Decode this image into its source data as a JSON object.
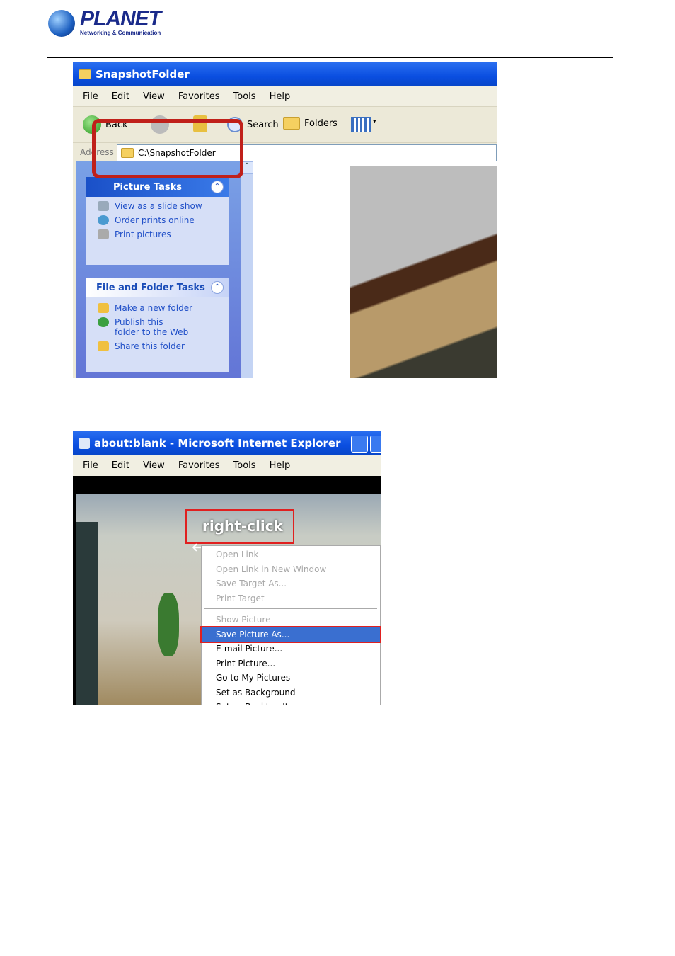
{
  "logo": {
    "brand": "PLANET",
    "tagline": "Networking & Communication"
  },
  "explorer": {
    "title": "SnapshotFolder",
    "menu": [
      "File",
      "Edit",
      "View",
      "Favorites",
      "Tools",
      "Help"
    ],
    "toolbar": {
      "back": "Back",
      "search": "Search",
      "folders": "Folders"
    },
    "address_label": "Address",
    "address_value": "C:\\SnapshotFolder",
    "picture_tasks": {
      "title": "Picture Tasks",
      "items": [
        "View as a slide show",
        "Order prints online",
        "Print pictures"
      ]
    },
    "file_folder_tasks": {
      "title": "File and Folder Tasks",
      "items": [
        "Make a new folder",
        "Publish this folder to the Web",
        "Share this folder"
      ]
    },
    "highlight_color": "#c0201a"
  },
  "ie": {
    "title": "about:blank - Microsoft Internet Explorer",
    "menu": [
      "File",
      "Edit",
      "View",
      "Favorites",
      "Tools",
      "Help"
    ],
    "callout": "right-click",
    "context_menu": {
      "disabled": [
        "Open Link",
        "Open Link in New Window",
        "Save Target As...",
        "Print Target"
      ],
      "show_picture": "Show Picture",
      "selected": "Save Picture As...",
      "items": [
        "E-mail Picture...",
        "Print Picture...",
        "Go to My Pictures",
        "Set as Background",
        "Set as Desktop Item..."
      ]
    }
  }
}
